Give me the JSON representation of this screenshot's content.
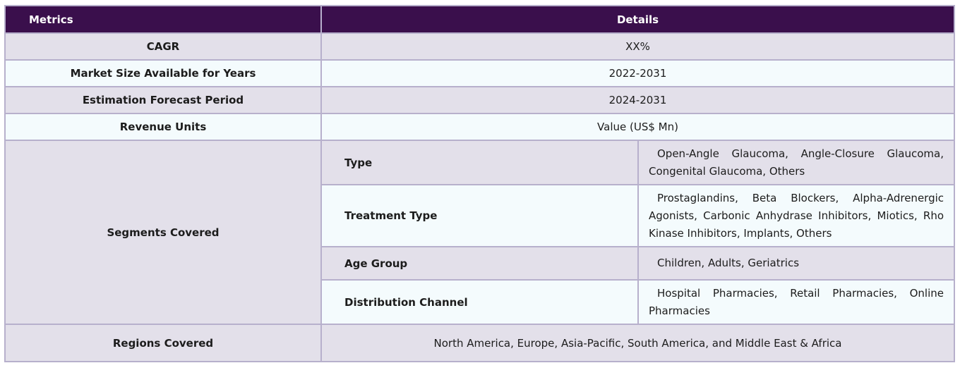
{
  "header": {
    "metrics": "Metrics",
    "details": "Details"
  },
  "rows": [
    {
      "metric": "CAGR",
      "detail": "XX%"
    },
    {
      "metric": "Market Size Available for Years",
      "detail": "2022-2031"
    },
    {
      "metric": "Estimation Forecast Period",
      "detail": "2024-2031"
    },
    {
      "metric": "Revenue Units",
      "detail": "Value (US$ Mn)"
    }
  ],
  "segments": {
    "label": "Segments Covered",
    "items": [
      {
        "name": "Type",
        "value": "Open-Angle Glaucoma, Angle-Closure Glaucoma, Congenital Glaucoma, Others"
      },
      {
        "name": "Treatment Type",
        "value": "Prostaglandins, Beta Blockers, Alpha-Adrenergic Agonists, Carbonic Anhydrase Inhibitors, Miotics, Rho Kinase Inhibitors, Implants, Others"
      },
      {
        "name": "Age Group",
        "value": "Children, Adults, Geriatrics"
      },
      {
        "name": "Distribution Channel",
        "value": "Hospital Pharmacies, Retail Pharmacies, Online Pharmacies"
      }
    ]
  },
  "regions": {
    "label": "Regions Covered",
    "value": "North America, Europe, Asia-Pacific, South America, and Middle East & Africa"
  },
  "colors": {
    "header_bg": "#3a0f4c",
    "row_shaded": "#e3e0ea",
    "row_light": "#f4fbfd",
    "border": "#b7b0cc"
  }
}
